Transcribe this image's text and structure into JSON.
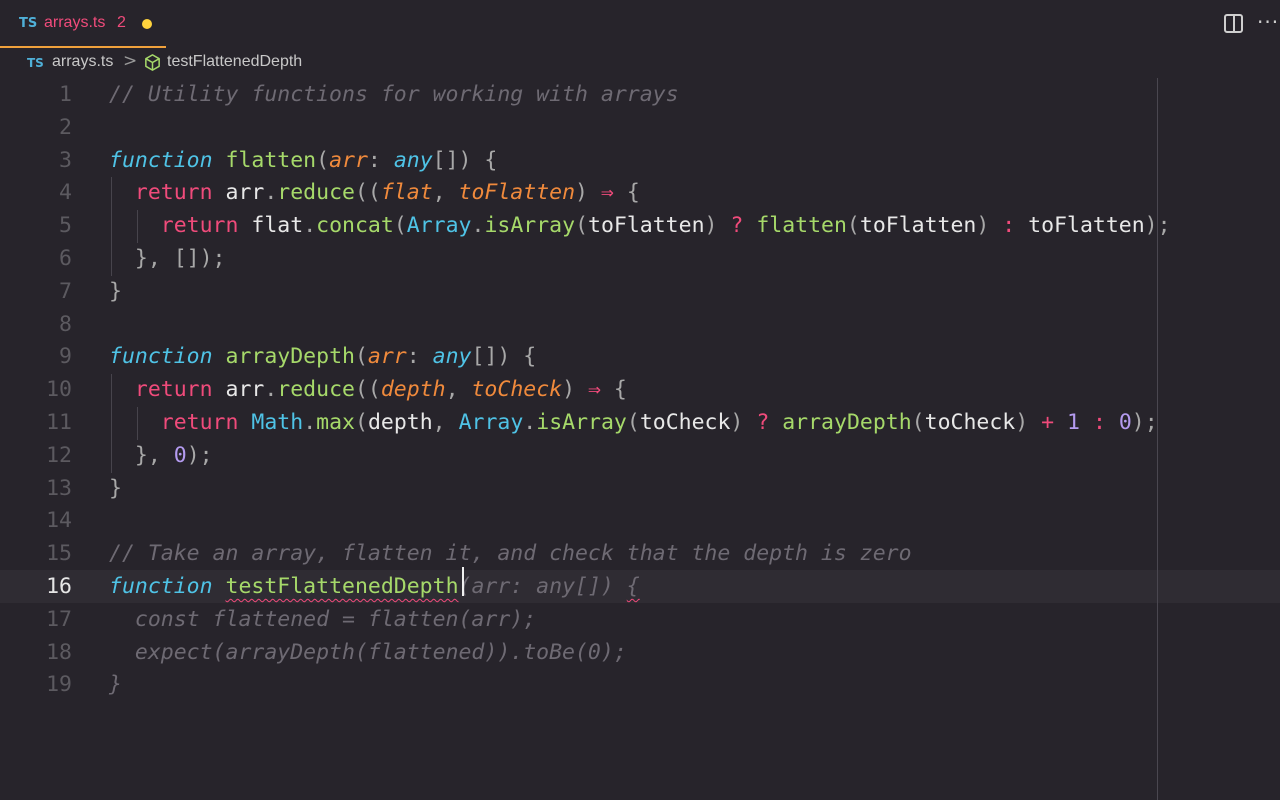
{
  "tab": {
    "lang_badge": "TS",
    "filename": "arrays.ts",
    "problem_count": "2",
    "modified_color": "#ffd33d"
  },
  "toolbar": {
    "split_icon": "split-editor-icon",
    "more_icon": "ellipsis-icon",
    "more_glyph": "···"
  },
  "breadcrumb": {
    "lang_badge": "TS",
    "file": "arrays.ts",
    "separator": ">",
    "symbol_icon": "cube-icon",
    "symbol": "testFlattenedDepth"
  },
  "editor": {
    "current_line": 16,
    "line_numbers": [
      "1",
      "2",
      "3",
      "4",
      "5",
      "6",
      "7",
      "8",
      "9",
      "10",
      "11",
      "12",
      "13",
      "14",
      "15",
      "16",
      "17",
      "18",
      "19"
    ],
    "lines": [
      [
        {
          "c": "cm",
          "t": "// Utility functions for working with arrays"
        }
      ],
      [],
      [
        {
          "c": "kw",
          "t": "function"
        },
        {
          "c": "tx",
          "t": " "
        },
        {
          "c": "fn",
          "t": "flatten"
        },
        {
          "c": "pu",
          "t": "("
        },
        {
          "c": "pa",
          "t": "arr"
        },
        {
          "c": "pu",
          "t": ": "
        },
        {
          "c": "ty",
          "t": "any"
        },
        {
          "c": "pu",
          "t": "[]) {"
        }
      ],
      [
        {
          "c": "tx",
          "t": "  "
        },
        {
          "c": "rt",
          "t": "return"
        },
        {
          "c": "tx",
          "t": " arr"
        },
        {
          "c": "pu",
          "t": "."
        },
        {
          "c": "fn",
          "t": "reduce"
        },
        {
          "c": "pu",
          "t": "(("
        },
        {
          "c": "pa",
          "t": "flat"
        },
        {
          "c": "pu",
          "t": ", "
        },
        {
          "c": "pa",
          "t": "toFlatten"
        },
        {
          "c": "pu",
          "t": ") "
        },
        {
          "c": "op",
          "t": "⇒"
        },
        {
          "c": "pu",
          "t": " {"
        }
      ],
      [
        {
          "c": "tx",
          "t": "    "
        },
        {
          "c": "rt",
          "t": "return"
        },
        {
          "c": "tx",
          "t": " flat"
        },
        {
          "c": "pu",
          "t": "."
        },
        {
          "c": "fn",
          "t": "concat"
        },
        {
          "c": "pu",
          "t": "("
        },
        {
          "c": "cl",
          "t": "Array"
        },
        {
          "c": "pu",
          "t": "."
        },
        {
          "c": "fn",
          "t": "isArray"
        },
        {
          "c": "pu",
          "t": "("
        },
        {
          "c": "tx",
          "t": "toFlatten"
        },
        {
          "c": "pu",
          "t": ") "
        },
        {
          "c": "op",
          "t": "?"
        },
        {
          "c": "tx",
          "t": " "
        },
        {
          "c": "fn",
          "t": "flatten"
        },
        {
          "c": "pu",
          "t": "("
        },
        {
          "c": "tx",
          "t": "toFlatten"
        },
        {
          "c": "pu",
          "t": ") "
        },
        {
          "c": "op",
          "t": ":"
        },
        {
          "c": "tx",
          "t": " toFlatten"
        },
        {
          "c": "pu",
          "t": ");"
        }
      ],
      [
        {
          "c": "pu",
          "t": "  }, []);"
        }
      ],
      [
        {
          "c": "pu",
          "t": "}"
        }
      ],
      [],
      [
        {
          "c": "kw",
          "t": "function"
        },
        {
          "c": "tx",
          "t": " "
        },
        {
          "c": "fn",
          "t": "arrayDepth"
        },
        {
          "c": "pu",
          "t": "("
        },
        {
          "c": "pa",
          "t": "arr"
        },
        {
          "c": "pu",
          "t": ": "
        },
        {
          "c": "ty",
          "t": "any"
        },
        {
          "c": "pu",
          "t": "[]) {"
        }
      ],
      [
        {
          "c": "tx",
          "t": "  "
        },
        {
          "c": "rt",
          "t": "return"
        },
        {
          "c": "tx",
          "t": " arr"
        },
        {
          "c": "pu",
          "t": "."
        },
        {
          "c": "fn",
          "t": "reduce"
        },
        {
          "c": "pu",
          "t": "(("
        },
        {
          "c": "pa",
          "t": "depth"
        },
        {
          "c": "pu",
          "t": ", "
        },
        {
          "c": "pa",
          "t": "toCheck"
        },
        {
          "c": "pu",
          "t": ") "
        },
        {
          "c": "op",
          "t": "⇒"
        },
        {
          "c": "pu",
          "t": " {"
        }
      ],
      [
        {
          "c": "tx",
          "t": "    "
        },
        {
          "c": "rt",
          "t": "return"
        },
        {
          "c": "tx",
          "t": " "
        },
        {
          "c": "cl",
          "t": "Math"
        },
        {
          "c": "pu",
          "t": "."
        },
        {
          "c": "fn",
          "t": "max"
        },
        {
          "c": "pu",
          "t": "("
        },
        {
          "c": "tx",
          "t": "depth"
        },
        {
          "c": "pu",
          "t": ", "
        },
        {
          "c": "cl",
          "t": "Array"
        },
        {
          "c": "pu",
          "t": "."
        },
        {
          "c": "fn",
          "t": "isArray"
        },
        {
          "c": "pu",
          "t": "("
        },
        {
          "c": "tx",
          "t": "toCheck"
        },
        {
          "c": "pu",
          "t": ") "
        },
        {
          "c": "op",
          "t": "?"
        },
        {
          "c": "tx",
          "t": " "
        },
        {
          "c": "fn",
          "t": "arrayDepth"
        },
        {
          "c": "pu",
          "t": "("
        },
        {
          "c": "tx",
          "t": "toCheck"
        },
        {
          "c": "pu",
          "t": ") "
        },
        {
          "c": "op",
          "t": "+"
        },
        {
          "c": "tx",
          "t": " "
        },
        {
          "c": "nu",
          "t": "1"
        },
        {
          "c": "tx",
          "t": " "
        },
        {
          "c": "op",
          "t": ":"
        },
        {
          "c": "tx",
          "t": " "
        },
        {
          "c": "nu",
          "t": "0"
        },
        {
          "c": "pu",
          "t": ");"
        }
      ],
      [
        {
          "c": "pu",
          "t": "  }, "
        },
        {
          "c": "nu",
          "t": "0"
        },
        {
          "c": "pu",
          "t": ");"
        }
      ],
      [
        {
          "c": "pu",
          "t": "}"
        }
      ],
      [],
      [
        {
          "c": "cm",
          "t": "// Take an array, flatten it, and check that the depth is zero"
        }
      ],
      [
        {
          "c": "kw",
          "t": "function"
        },
        {
          "c": "tx",
          "t": " "
        },
        {
          "c": "fn squig",
          "t": "testFlattenedDepth"
        },
        {
          "c": "gh",
          "t": "(arr: any[]) "
        },
        {
          "c": "gh squig",
          "t": "{"
        }
      ],
      [
        {
          "c": "gh",
          "t": "  const flattened = flatten(arr);"
        }
      ],
      [
        {
          "c": "gh",
          "t": "  expect(arrayDepth(flattened)).toBe(0);"
        }
      ],
      [
        {
          "c": "gh",
          "t": "}"
        }
      ]
    ]
  }
}
